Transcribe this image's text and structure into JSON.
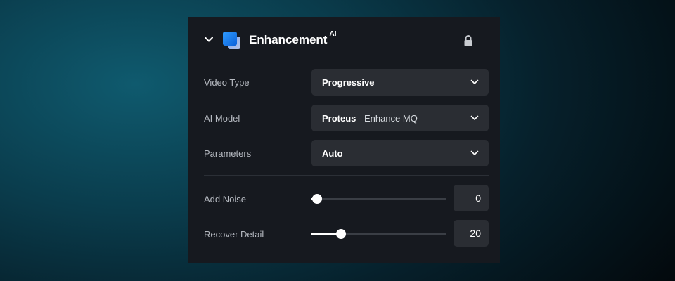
{
  "panel": {
    "title": "Enhancement",
    "title_badge": "AI",
    "icons": {
      "collapse": "chevron-down-icon",
      "app": "enhancement-app-icon",
      "lock": "lock-icon"
    }
  },
  "fields": {
    "video_type": {
      "label": "Video Type",
      "value": "Progressive"
    },
    "ai_model": {
      "label": "AI Model",
      "value_main": "Proteus",
      "value_sub": " - Enhance MQ"
    },
    "parameters": {
      "label": "Parameters",
      "value": "Auto"
    }
  },
  "sliders": {
    "add_noise": {
      "label": "Add Noise",
      "value": "0",
      "fill_percent": 4
    },
    "recover_detail": {
      "label": "Recover Detail",
      "value": "20",
      "fill_percent": 22
    }
  },
  "colors": {
    "panel_bg": "#16191f",
    "control_bg": "#2a2d33",
    "accent_icon": "#2f9cff",
    "text_primary": "#ffffff",
    "text_label": "#b5b9c0"
  }
}
